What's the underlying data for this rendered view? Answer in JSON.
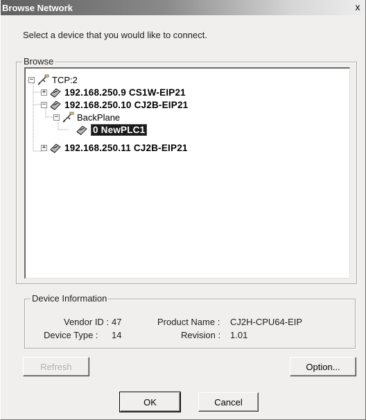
{
  "window": {
    "title": "Browse Network",
    "close_glyph": "x"
  },
  "instruction": "Select a device that you would like to connect.",
  "browse": {
    "group_label": "Browse",
    "tree": [
      {
        "label": "TCP:2",
        "icon": "network-cable-icon",
        "expander": "−",
        "bold": false
      },
      {
        "label": "192.168.250.9 CS1W-EIP21",
        "icon": "plc-device-icon",
        "expander": "+",
        "bold": true
      },
      {
        "label": "192.168.250.10 CJ2B-EIP21",
        "icon": "plc-device-icon",
        "expander": "−",
        "bold": true
      },
      {
        "label": "BackPlane",
        "icon": "network-cable-icon",
        "expander": "−",
        "bold": false
      },
      {
        "label": "0 NewPLC1",
        "icon": "plc-device-icon",
        "expander": "",
        "bold": true,
        "selected": true
      },
      {
        "label": "192.168.250.11 CJ2B-EIP21",
        "icon": "plc-device-icon",
        "expander": "+",
        "bold": true
      }
    ]
  },
  "device_info": {
    "group_label": "Device Information",
    "vendor_id_label": "Vendor ID :",
    "vendor_id_value": "47",
    "device_type_label": "Device Type :",
    "device_type_value": "14",
    "product_name_label": "Product Name :",
    "product_name_value": "CJ2H-CPU64-EIP",
    "revision_label": "Revision :",
    "revision_value": "1.01"
  },
  "buttons": {
    "refresh": "Refresh",
    "option": "Option...",
    "ok": "OK",
    "cancel": "Cancel"
  },
  "colors": {
    "face": "#f0efed",
    "selection": "#1a1a1a"
  }
}
